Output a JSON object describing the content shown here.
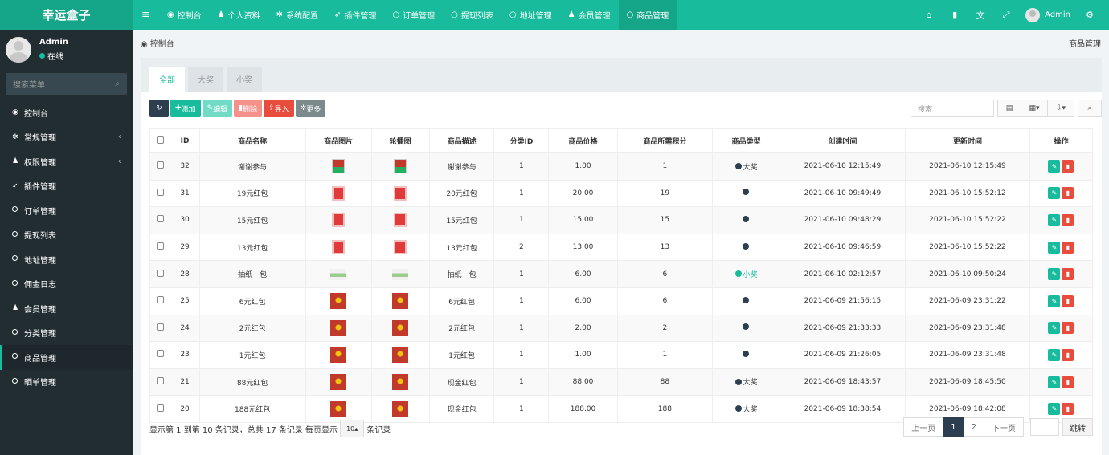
{
  "app": {
    "logo": "幸运盒子",
    "colors": {
      "primary": "#18bc9c",
      "sidebar": "#222d32",
      "danger": "#e74c3c",
      "dark": "#2c3e50"
    }
  },
  "topnav": {
    "items": [
      {
        "label": "控制台",
        "icon": "dashboard-icon"
      },
      {
        "label": "个人资料",
        "icon": "user-icon"
      },
      {
        "label": "系统配置",
        "icon": "gear-icon"
      },
      {
        "label": "插件管理",
        "icon": "rocket-icon"
      },
      {
        "label": "订单管理",
        "icon": "circle-icon"
      },
      {
        "label": "提现列表",
        "icon": "circle-icon"
      },
      {
        "label": "地址管理",
        "icon": "circle-icon"
      },
      {
        "label": "会员管理",
        "icon": "user-icon"
      },
      {
        "label": "商品管理",
        "icon": "circle-icon"
      }
    ],
    "user": "Admin"
  },
  "sidebar": {
    "user": {
      "name": "Admin",
      "status": "在线"
    },
    "search_placeholder": "搜索菜单",
    "items": [
      {
        "label": "控制台",
        "icon": "dashboard-icon"
      },
      {
        "label": "常规管理",
        "icon": "cogs-icon"
      },
      {
        "label": "权限管理",
        "icon": "group-icon"
      },
      {
        "label": "插件管理",
        "icon": "rocket-icon"
      },
      {
        "label": "订单管理",
        "icon": "circle-icon"
      },
      {
        "label": "提现列表",
        "icon": "circle-icon"
      },
      {
        "label": "地址管理",
        "icon": "circle-icon"
      },
      {
        "label": "佣金日志",
        "icon": "circle-icon"
      },
      {
        "label": "会员管理",
        "icon": "user-icon"
      },
      {
        "label": "分类管理",
        "icon": "circle-icon"
      },
      {
        "label": "商品管理",
        "icon": "circle-icon"
      },
      {
        "label": "晒单管理",
        "icon": "circle-icon"
      }
    ]
  },
  "breadcrumb": {
    "left": "控制台",
    "right": "商品管理"
  },
  "tabs": [
    "全部",
    "大奖",
    "小奖"
  ],
  "toolbar": {
    "add": "添加",
    "edit": "编辑",
    "delete": "删除",
    "import": "导入",
    "more": "更多",
    "search_placeholder": "搜索"
  },
  "table": {
    "headers": [
      "ID",
      "商品名称",
      "商品图片",
      "轮播图",
      "商品描述",
      "分类ID",
      "商品价格",
      "商品所需积分",
      "商品类型",
      "创建时间",
      "更新时间",
      "操作"
    ],
    "rows": [
      {
        "id": "32",
        "name": "谢谢参与",
        "desc": "谢谢参与",
        "cat": "1",
        "price": "1.00",
        "points": "1",
        "type": "大奖",
        "created": "2021-06-10 12:15:49",
        "updated": "2021-06-10 12:15:49"
      },
      {
        "id": "31",
        "name": "19元红包",
        "desc": "20元红包",
        "cat": "1",
        "price": "20.00",
        "points": "19",
        "type": "",
        "created": "2021-06-10 09:49:49",
        "updated": "2021-06-10 15:52:12"
      },
      {
        "id": "30",
        "name": "15元红包",
        "desc": "15元红包",
        "cat": "1",
        "price": "15.00",
        "points": "15",
        "type": "",
        "created": "2021-06-10 09:48:29",
        "updated": "2021-06-10 15:52:22"
      },
      {
        "id": "29",
        "name": "13元红包",
        "desc": "13元红包",
        "cat": "2",
        "price": "13.00",
        "points": "13",
        "type": "",
        "created": "2021-06-10 09:46:59",
        "updated": "2021-06-10 15:52:22"
      },
      {
        "id": "28",
        "name": "抽纸一包",
        "desc": "抽纸一包",
        "cat": "1",
        "price": "6.00",
        "points": "6",
        "type": "小奖",
        "created": "2021-06-10 02:12:57",
        "updated": "2021-06-10 09:50:24"
      },
      {
        "id": "25",
        "name": "6元红包",
        "desc": "6元红包",
        "cat": "1",
        "price": "6.00",
        "points": "6",
        "type": "",
        "created": "2021-06-09 21:56:15",
        "updated": "2021-06-09 23:31:22"
      },
      {
        "id": "24",
        "name": "2元红包",
        "desc": "2元红包",
        "cat": "1",
        "price": "2.00",
        "points": "2",
        "type": "",
        "created": "2021-06-09 21:33:33",
        "updated": "2021-06-09 23:31:48"
      },
      {
        "id": "23",
        "name": "1元红包",
        "desc": "1元红包",
        "cat": "1",
        "price": "1.00",
        "points": "1",
        "type": "",
        "created": "2021-06-09 21:26:05",
        "updated": "2021-06-09 23:31:48"
      },
      {
        "id": "21",
        "name": "88元红包",
        "desc": "现金红包",
        "cat": "1",
        "price": "88.00",
        "points": "88",
        "type": "大奖",
        "created": "2021-06-09 18:43:57",
        "updated": "2021-06-09 18:45:50"
      },
      {
        "id": "20",
        "name": "188元红包",
        "desc": "现金红包",
        "cat": "1",
        "price": "188.00",
        "points": "188",
        "type": "大奖",
        "created": "2021-06-09 18:38:54",
        "updated": "2021-06-09 18:42:08"
      }
    ]
  },
  "footer": {
    "summary": "显示第 1 到第 10 条记录，总共 17 条记录 每页显示",
    "page_size": "10",
    "records_suffix": "条记录",
    "prev": "上一页",
    "pages": [
      "1",
      "2"
    ],
    "next": "下一页",
    "jump": "跳转"
  }
}
